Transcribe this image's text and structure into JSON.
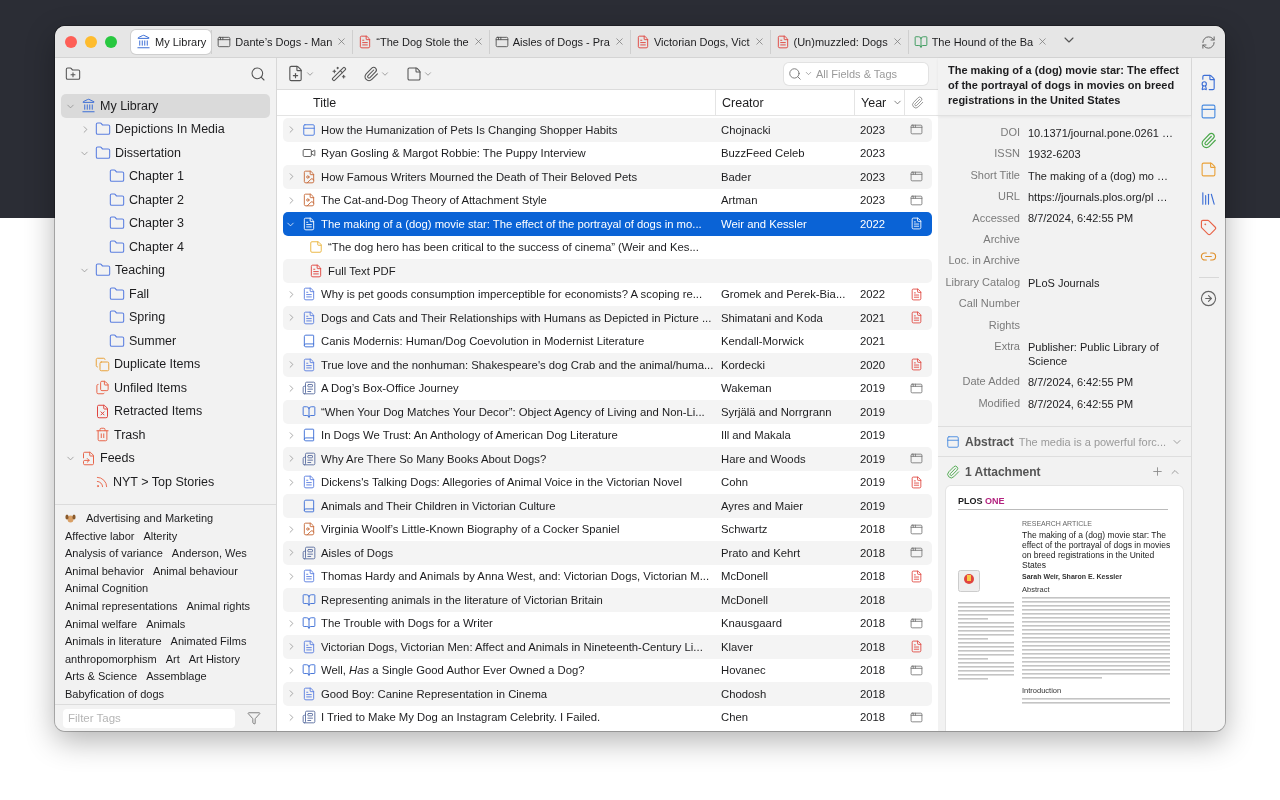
{
  "tabs": [
    {
      "kind": "library",
      "title": "My Library",
      "selected": true
    },
    {
      "kind": "snapshot",
      "title": "Dante’s Dogs - Man",
      "selected": false
    },
    {
      "kind": "pdf",
      "title": "“The Dog Stole the",
      "selected": false
    },
    {
      "kind": "snapshot",
      "title": "Aisles of Dogs - Pra",
      "selected": false
    },
    {
      "kind": "pdf",
      "title": "Victorian Dogs, Vict",
      "selected": false
    },
    {
      "kind": "pdf",
      "title": "(Un)muzzled: Dogs",
      "selected": false
    },
    {
      "kind": "epub",
      "title": "The Hound of the Ba",
      "selected": false
    }
  ],
  "collections_pane": {
    "tree": [
      {
        "kind": "library",
        "label": "My Library",
        "expanded": true,
        "selected": true,
        "children": [
          {
            "kind": "folder",
            "label": "Depictions In Media",
            "expanded": false,
            "selected": false
          },
          {
            "kind": "folder",
            "label": "Dissertation",
            "expanded": true,
            "selected": false,
            "children": [
              {
                "kind": "folder",
                "label": "Chapter 1",
                "selected": false
              },
              {
                "kind": "folder",
                "label": "Chapter 2",
                "selected": false
              },
              {
                "kind": "folder",
                "label": "Chapter 3",
                "selected": false
              },
              {
                "kind": "folder",
                "label": "Chapter 4",
                "selected": false
              }
            ]
          },
          {
            "kind": "folder",
            "label": "Teaching",
            "expanded": true,
            "selected": false,
            "children": [
              {
                "kind": "folder",
                "label": "Fall",
                "selected": false
              },
              {
                "kind": "folder",
                "label": "Spring",
                "selected": false
              },
              {
                "kind": "folder",
                "label": "Summer",
                "selected": false
              }
            ]
          },
          {
            "kind": "duplicates",
            "label": "Duplicate Items",
            "selected": false
          },
          {
            "kind": "unfiled",
            "label": "Unfiled Items",
            "selected": false
          },
          {
            "kind": "retracted",
            "label": "Retracted Items",
            "selected": false
          },
          {
            "kind": "trash",
            "label": "Trash",
            "selected": false
          }
        ]
      },
      {
        "kind": "feeds",
        "label": "Feeds",
        "expanded": true,
        "selected": false,
        "children": [
          {
            "kind": "feed",
            "label": "NYT > Top Stories",
            "selected": false
          }
        ]
      }
    ],
    "tags": [
      {
        "kind": "emoji",
        "label": "Advertising and Marketing"
      },
      {
        "kind": "plain",
        "label": "Affective labor"
      },
      {
        "kind": "plain",
        "label": "Alterity"
      },
      {
        "kind": "plain",
        "label": "Analysis of variance"
      },
      {
        "kind": "plain",
        "label": "Anderson, Wes"
      },
      {
        "kind": "plain",
        "label": "Animal behavior"
      },
      {
        "kind": "plain",
        "label": "Animal behaviour"
      },
      {
        "kind": "plain",
        "label": "Animal Cognition"
      },
      {
        "kind": "plain",
        "label": "Animal representations"
      },
      {
        "kind": "plain",
        "label": "Animal rights"
      },
      {
        "kind": "plain",
        "label": "Animal welfare"
      },
      {
        "kind": "plain",
        "label": "Animals"
      },
      {
        "kind": "plain",
        "label": "Animals in literature"
      },
      {
        "kind": "plain",
        "label": "Animated Films"
      },
      {
        "kind": "plain",
        "label": "anthropomorphism"
      },
      {
        "kind": "plain",
        "label": "Art"
      },
      {
        "kind": "plain",
        "label": "Art History"
      },
      {
        "kind": "plain",
        "label": "Arts & Science"
      },
      {
        "kind": "plain",
        "label": "Assemblage"
      },
      {
        "kind": "plain",
        "label": "Babyfication of dogs"
      }
    ],
    "filter_placeholder": "Filter Tags"
  },
  "items_toolbar": {
    "search_placeholder": "All Fields & Tags"
  },
  "items_table": {
    "columns": [
      {
        "label": "Title",
        "sorted": false
      },
      {
        "label": "Creator",
        "sorted": false
      },
      {
        "label": "Year",
        "sorted": true
      }
    ],
    "rows": [
      {
        "kind": "webpage",
        "expanded": false,
        "selected": false,
        "title": "How the Humanization of Pets Is Changing Shopper Habits",
        "creator": "Chojnacki",
        "year": "2023",
        "attachment": {
          "kind": "snapshot"
        }
      },
      {
        "kind": "video",
        "selected": false,
        "title": "Ryan Gosling & Margot Robbie: The Puppy Interview",
        "creator": "BuzzFeed Celeb",
        "year": "2023"
      },
      {
        "kind": "magazine",
        "expanded": false,
        "selected": false,
        "title": "How Famous Writers Mourned the Death of Their Beloved Pets",
        "creator": "Bader",
        "year": "2023",
        "attachment": {
          "kind": "snapshot"
        }
      },
      {
        "kind": "magazine",
        "expanded": false,
        "selected": false,
        "title": "The Cat-and-Dog Theory of Attachment Style",
        "creator": "Artman",
        "year": "2023",
        "attachment": {
          "kind": "snapshot"
        }
      },
      {
        "kind": "journal",
        "expanded": true,
        "selected": true,
        "title": "The making of a (dog) movie star: The effect of the portrayal of dogs in mo...",
        "creator": "Weir and Kessler",
        "year": "2022",
        "attachment": {
          "kind": "pdf"
        },
        "children": [
          {
            "kind": "note",
            "title": "“The dog hero has been critical to the success of cinema” (Weir and Kes..."
          },
          {
            "kind": "pdf",
            "title": "Full Text PDF"
          }
        ]
      },
      {
        "kind": "journal",
        "expanded": false,
        "selected": false,
        "title": "Why is pet goods consumption imperceptible for economists? A scoping re...",
        "creator": "Gromek and Perek-Bia...",
        "year": "2022",
        "attachment": {
          "kind": "pdf"
        }
      },
      {
        "kind": "journal",
        "expanded": false,
        "selected": false,
        "title": "Dogs and Cats and Their Relationships with Humans as Depicted in Picture ...",
        "creator": "Shimatani and Koda",
        "year": "2021",
        "attachment": {
          "kind": "pdf"
        }
      },
      {
        "kind": "book",
        "selected": false,
        "title": "Canis Modernis: Human/Dog Coevolution in Modernist Literature",
        "creator": "Kendall-Morwick",
        "year": "2021"
      },
      {
        "kind": "journal",
        "expanded": false,
        "selected": false,
        "title": "True love and the nonhuman: Shakespeare's dog Crab and the animal/huma...",
        "creator": "Kordecki",
        "year": "2020",
        "attachment": {
          "kind": "pdf"
        }
      },
      {
        "kind": "newspaper",
        "expanded": false,
        "selected": false,
        "title": "A Dog’s Box-Office Journey",
        "creator": "Wakeman",
        "year": "2019",
        "attachment": {
          "kind": "snapshot"
        }
      },
      {
        "kind": "section",
        "selected": false,
        "title": "“When Your Dog Matches Your Decor”: Object Agency of Living and Non-Li...",
        "creator": "Syrjälä and Norrgrann",
        "year": "2019"
      },
      {
        "kind": "book",
        "expanded": false,
        "selected": false,
        "title": "In Dogs We Trust: An Anthology of American Dog Literature",
        "creator": "Ill and Makala",
        "year": "2019"
      },
      {
        "kind": "newspaper",
        "expanded": false,
        "selected": false,
        "title": "Why Are There So Many Books About Dogs?",
        "creator": "Hare and Woods",
        "year": "2019",
        "attachment": {
          "kind": "snapshot"
        }
      },
      {
        "kind": "journal",
        "expanded": false,
        "selected": false,
        "title": "Dickens's Talking Dogs: Allegories of Animal Voice in the Victorian Novel",
        "creator": "Cohn",
        "year": "2019",
        "attachment": {
          "kind": "pdf"
        }
      },
      {
        "kind": "book",
        "selected": false,
        "title": "Animals and Their Children in Victorian Culture",
        "creator": "Ayres and Maier",
        "year": "2019"
      },
      {
        "kind": "magazine",
        "expanded": false,
        "selected": false,
        "title": "Virginia Woolf’s Little-Known Biography of a Cocker Spaniel",
        "creator": "Schwartz",
        "year": "2018",
        "attachment": {
          "kind": "snapshot"
        }
      },
      {
        "kind": "newspaper",
        "expanded": false,
        "selected": false,
        "title": "Aisles of Dogs",
        "creator": "Prato and Kehrt",
        "year": "2018",
        "attachment": {
          "kind": "snapshot"
        }
      },
      {
        "kind": "journal",
        "expanded": false,
        "selected": false,
        "title": "Thomas Hardy and Animals by Anna West, and: Victorian Dogs, Victorian M...",
        "creator": "McDonell",
        "year": "2018",
        "attachment": {
          "kind": "pdf"
        }
      },
      {
        "kind": "section",
        "selected": false,
        "title": "Representing animals in the literature of Victorian Britain",
        "creator": "McDonell",
        "year": "2018"
      },
      {
        "kind": "section",
        "expanded": false,
        "selected": false,
        "title": "The Trouble with Dogs for a Writer",
        "creator": "Knausgaard",
        "year": "2018",
        "attachment": {
          "kind": "snapshot"
        }
      },
      {
        "kind": "journal",
        "expanded": false,
        "selected": false,
        "title": "Victorian Dogs, Victorian Men: Affect and Animals in Nineteenth-Century Li...",
        "creator": "Klaver",
        "year": "2018",
        "attachment": {
          "kind": "pdf"
        }
      },
      {
        "kind": "section",
        "expanded": false,
        "selected": false,
        "title": "Well, *Has* a Single Good Author Ever Owned a Dog?",
        "creator": "Hovanec",
        "year": "2018",
        "attachment": {
          "kind": "snapshot"
        }
      },
      {
        "kind": "journal",
        "expanded": false,
        "selected": false,
        "title": "Good Boy: Canine Representation in Cinema",
        "creator": "Chodosh",
        "year": "2018"
      },
      {
        "kind": "newspaper",
        "expanded": false,
        "selected": false,
        "title": "I Tried to Make My Dog an Instagram Celebrity. I Failed.",
        "creator": "Chen",
        "year": "2018",
        "attachment": {
          "kind": "snapshot"
        }
      }
    ]
  },
  "item_pane": {
    "title": "The making of a (dog) movie star: The effect of the portrayal of dogs in movies on breed registrations in the United States",
    "fields": [
      {
        "label": "DOI",
        "value": "10.1371/journal.pone.0261 …"
      },
      {
        "label": "ISSN",
        "value": "1932-6203"
      },
      {
        "label": "Short Title",
        "value": "The making of a (dog) mo …"
      },
      {
        "label": "URL",
        "value": "https://journals.plos.org/pl …"
      },
      {
        "label": "Accessed",
        "value": "8/7/2024, 6:42:55 PM"
      },
      {
        "label": "Archive"
      },
      {
        "label": "Loc. in Archive"
      },
      {
        "label": "Library Catalog",
        "value": "PLoS Journals"
      },
      {
        "label": "Call Number"
      },
      {
        "label": "Rights"
      },
      {
        "label": "Extra",
        "value": "Publisher: Public Library of Science"
      },
      {
        "label": "Date Added",
        "value": "8/7/2024, 6:42:55 PM"
      },
      {
        "label": "Modified",
        "value": "8/7/2024, 6:42:55 PM"
      }
    ],
    "abstract": {
      "heading": "Abstract",
      "preview": "The media is a powerful forc..."
    },
    "attachments": {
      "heading": "1 Attachment",
      "preview": {
        "journal": "PLOS",
        "journal_accent": "ONE",
        "article_type": "RESEARCH ARTICLE",
        "title": "The making of a (dog) movie star: The effect of the portrayal of dogs in movies on breed registrations in the United States",
        "authors": "Sarah Weir, Sharon E. Kessler",
        "abstract_heading": "Abstract",
        "introduction_heading": "Introduction"
      }
    }
  }
}
